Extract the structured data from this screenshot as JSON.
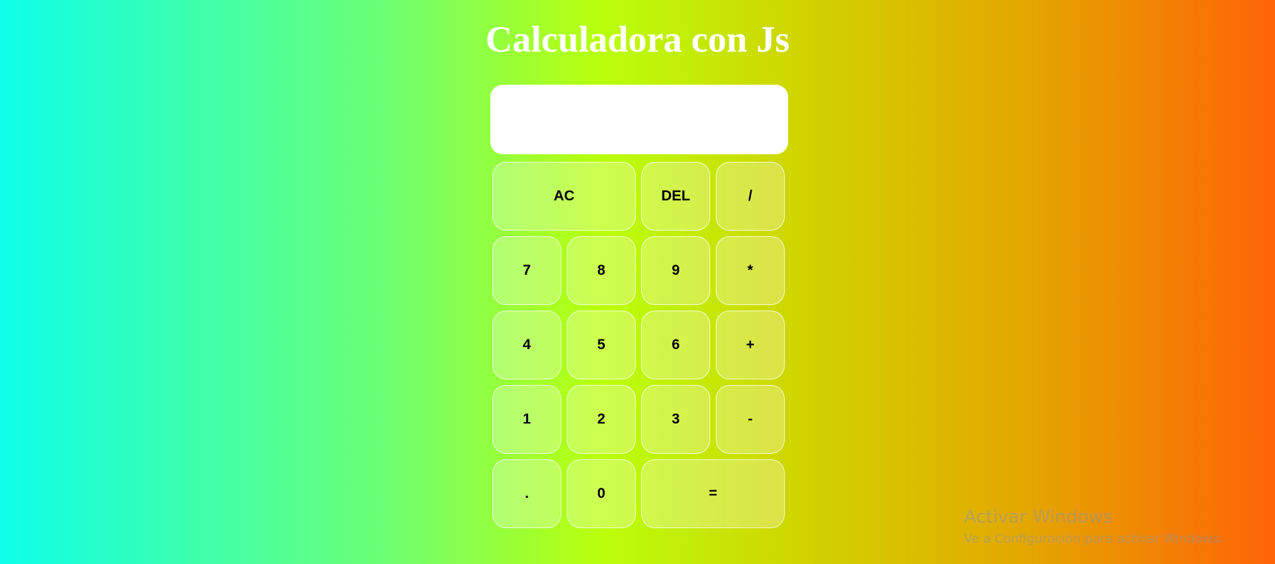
{
  "page": {
    "title": "Calculadora con Js",
    "background_colors": [
      "#0dffe9",
      "#6bff74",
      "#b9ff0c",
      "#cfd600",
      "#e3a800",
      "#ff6306"
    ]
  },
  "display": {
    "value": ""
  },
  "keys": {
    "ac": "AC",
    "del": "DEL",
    "divide": "/",
    "seven": "7",
    "eight": "8",
    "nine": "9",
    "multiply": "*",
    "four": "4",
    "five": "5",
    "six": "6",
    "plus": "+",
    "one": "1",
    "two": "2",
    "three": "3",
    "minus": "-",
    "dot": ".",
    "zero": "0",
    "equals": "="
  },
  "watermark": {
    "title": "Activar Windows",
    "subtitle": "Ve a Configuración para activar Windows."
  }
}
